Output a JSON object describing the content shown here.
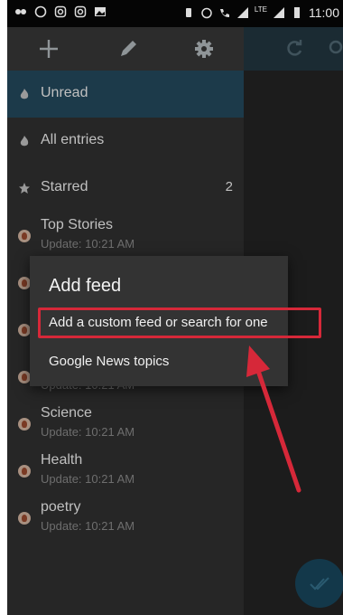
{
  "status_bar": {
    "time": "11:00",
    "network": "LTE"
  },
  "toolbar": {
    "add_icon": "plus-icon",
    "edit_icon": "pencil-icon",
    "settings_icon": "gear-icon"
  },
  "right_toolbar": {
    "refresh_icon": "refresh-icon",
    "search_icon": "search-icon"
  },
  "nav": [
    {
      "label": "Unread",
      "icon": "flame-icon",
      "selected": true
    },
    {
      "label": "All entries",
      "icon": "flame-icon"
    },
    {
      "label": "Starred",
      "icon": "star-icon",
      "count": "2"
    }
  ],
  "feeds": [
    {
      "name": "Top Stories",
      "update": "Update: 10:21 AM"
    },
    {
      "name": "",
      "update": ""
    },
    {
      "name": "",
      "update": ""
    },
    {
      "name": "",
      "update": "Update: 10:21 AM"
    },
    {
      "name": "Science",
      "update": "Update: 10:21 AM"
    },
    {
      "name": "Health",
      "update": "Update: 10:21 AM"
    },
    {
      "name": "poetry",
      "update": "Update: 10:21 AM"
    }
  ],
  "dialog": {
    "title": "Add feed",
    "option_custom": "Add a custom feed or search for one",
    "option_google": "Google News topics"
  },
  "colors": {
    "highlight": "#d62839",
    "arrow": "#d62839",
    "selected_bg": "#1c3a4a"
  }
}
